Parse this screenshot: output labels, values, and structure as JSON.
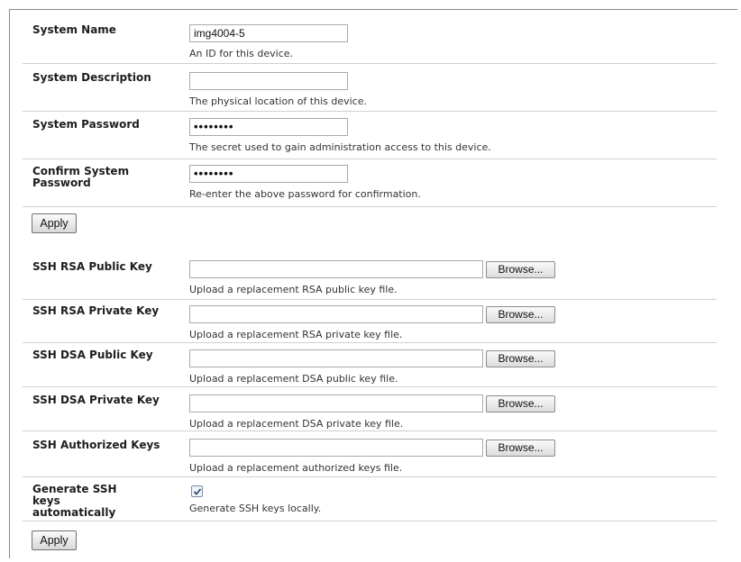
{
  "system": {
    "name": {
      "label": "System Name",
      "value": "img4004-5",
      "help": "An ID for this device."
    },
    "description": {
      "label": "System Description",
      "value": "",
      "help": "The physical location of this device."
    },
    "password": {
      "label": "System Password",
      "value": "••••••••",
      "help": "The secret used to gain administration access to this device."
    },
    "confirm_password": {
      "label": "Confirm System Password",
      "value": "••••••••",
      "help": "Re-enter the above password for confirmation."
    },
    "apply_label": "Apply"
  },
  "ssh": {
    "browse_label": "Browse...",
    "rsa_public": {
      "label": "SSH RSA Public Key",
      "help": "Upload a replacement RSA public key file."
    },
    "rsa_private": {
      "label": "SSH RSA Private Key",
      "help": "Upload a replacement RSA private key file."
    },
    "dsa_public": {
      "label": "SSH DSA Public Key",
      "help": "Upload a replacement DSA public key file."
    },
    "dsa_private": {
      "label": "SSH DSA Private Key",
      "help": "Upload a replacement DSA private key file."
    },
    "authorized": {
      "label": "SSH Authorized Keys",
      "help": "Upload a replacement authorized keys file."
    },
    "generate": {
      "label": "Generate SSH keys automatically",
      "checked": true,
      "help": "Generate SSH keys locally."
    },
    "apply_label": "Apply"
  }
}
